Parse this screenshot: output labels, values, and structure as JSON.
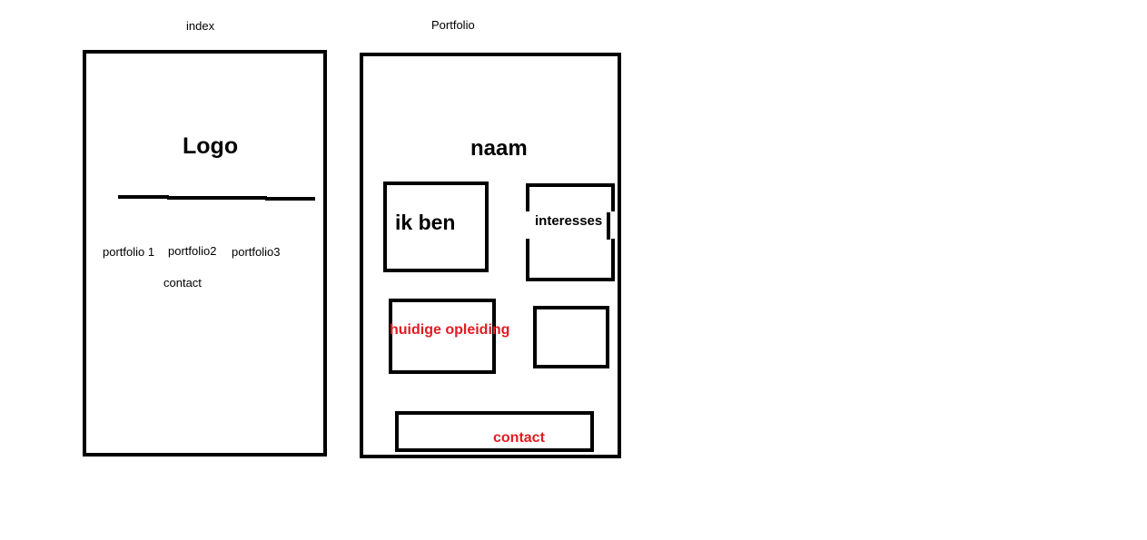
{
  "index": {
    "caption": "index",
    "logo": "Logo",
    "nav": {
      "portfolio1": "portfolio 1",
      "portfolio2": "portfolio2",
      "portfolio3": "portfolio3",
      "contact": "contact"
    }
  },
  "portfolio": {
    "caption": "Portfolio",
    "name": "naam",
    "about": "ik ben",
    "interests": "interesses",
    "education": "huidige opleiding",
    "contact": "contact"
  },
  "colors": {
    "stroke": "#000000",
    "accent": "#e11b22"
  }
}
